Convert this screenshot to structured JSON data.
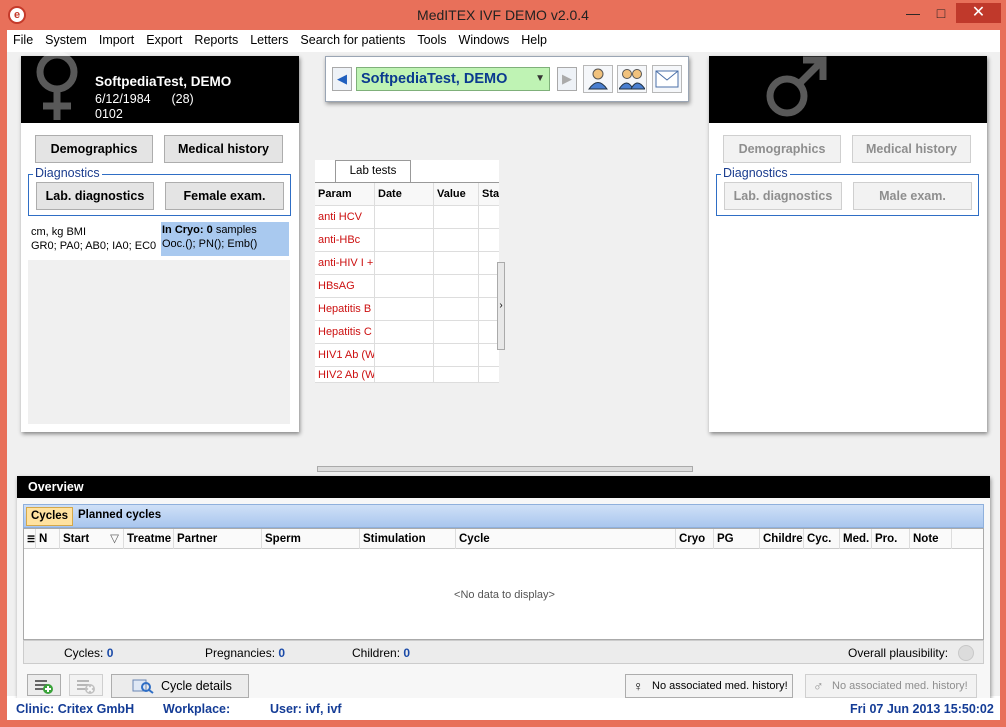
{
  "window": {
    "title": "MedITEX IVF DEMO v2.0.4",
    "app_icon": "e"
  },
  "menu": [
    "File",
    "System",
    "Import",
    "Export",
    "Reports",
    "Letters",
    "Search for patients",
    "Tools",
    "Windows",
    "Help"
  ],
  "female": {
    "name": "SoftpediaTest, DEMO",
    "dob": "6/12/1984",
    "age": "(28)",
    "id": "0102",
    "demographics": "Demographics",
    "medical_history": "Medical history",
    "diagnostics_label": "Diagnostics",
    "lab": "Lab. diagnostics",
    "exam": "Female exam.",
    "bmi": "cm, kg BMI",
    "gr": "GR0; PA0; AB0; IA0; EC0",
    "cryo_label": "In Cryo:",
    "cryo_count": "0",
    "cryo_unit": "samples",
    "cryo_detail": "Ooc.(); PN(); Emb()"
  },
  "male": {
    "demographics": "Demographics",
    "medical_history": "Medical history",
    "diagnostics_label": "Diagnostics",
    "lab": "Lab. diagnostics",
    "exam": "Male exam."
  },
  "selector": {
    "patient": "SoftpediaTest, DEMO"
  },
  "lab_tests": {
    "tab": "Lab tests",
    "columns": [
      "Param",
      "Date",
      "Value",
      "Sta"
    ],
    "rows": [
      "anti HCV",
      "anti-HBc",
      "anti-HIV I +",
      "HBsAG",
      "Hepatitis B",
      "Hepatitis C",
      "HIV1 Ab (W",
      "HIV2 Ab (W"
    ]
  },
  "overview": {
    "title": "Overview",
    "tabs": [
      "Cycles",
      "Planned cycles"
    ],
    "columns": [
      "N",
      "Start",
      "Treatme",
      "Partner",
      "Sperm",
      "Stimulation",
      "Cycle",
      "Cryo",
      "PG",
      "Childre",
      "Cyc.",
      "Med.",
      "Pro.",
      "Note"
    ],
    "no_data": "<No data to display>",
    "cycles_label": "Cycles:",
    "cycles": "0",
    "pregnancies_label": "Pregnancies:",
    "pregnancies": "0",
    "children_label": "Children:",
    "children": "0",
    "plausibility_label": "Overall plausibility:",
    "cycle_details": "Cycle details",
    "female_history": "No associated med. history!",
    "male_history": "No associated med. history!"
  },
  "status": {
    "clinic_label": "Clinic:",
    "clinic": "Critex GmbH",
    "workplace_label": "Workplace:",
    "user_label": "User:",
    "user": "ivf, ivf",
    "datetime": "Fri 07 Jun 2013 15:50:02"
  }
}
